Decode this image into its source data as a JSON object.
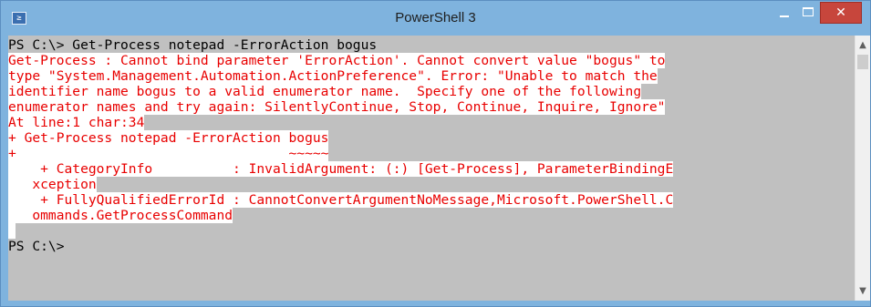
{
  "window": {
    "title": "PowerShell 3",
    "icon": "powershell-icon",
    "icon_glyph": "≥",
    "close_glyph": "✕"
  },
  "console": {
    "lines": [
      {
        "text": "PS C:\\> Get-Process notepad -ErrorAction bogus",
        "style": "normal"
      },
      {
        "text": "Get-Process : Cannot bind parameter 'ErrorAction'. Cannot convert value \"bogus\" to",
        "style": "error"
      },
      {
        "text": "type \"System.Management.Automation.ActionPreference\". Error: \"Unable to match the",
        "style": "error"
      },
      {
        "text": "identifier name bogus to a valid enumerator name.  Specify one of the following",
        "style": "error"
      },
      {
        "text": "enumerator names and try again: SilentlyContinue, Stop, Continue, Inquire, Ignore\"",
        "style": "error"
      },
      {
        "text": "At line:1 char:34",
        "style": "error"
      },
      {
        "text": "+ Get-Process notepad -ErrorAction bogus",
        "style": "error"
      },
      {
        "text": "+                                  ~~~~~",
        "style": "error"
      },
      {
        "text": "    + CategoryInfo          : InvalidArgument: (:) [Get-Process], ParameterBindingE",
        "style": "error"
      },
      {
        "text": "   xception",
        "style": "error"
      },
      {
        "text": "    + FullyQualifiedErrorId : CannotConvertArgumentNoMessage,Microsoft.PowerShell.C",
        "style": "error"
      },
      {
        "text": "   ommands.GetProcessCommand",
        "style": "error"
      },
      {
        "text": "",
        "style": "error-blank"
      },
      {
        "text": "PS C:\\>",
        "style": "normal"
      }
    ]
  },
  "scrollbar": {
    "up_arrow": "▲",
    "down_arrow": "▼"
  },
  "colors": {
    "titlebar": "#7fb3de",
    "console_background": "#c0c0c0",
    "error_text": "#e80000",
    "error_background": "#ffffff",
    "close_button": "#c7463c"
  }
}
